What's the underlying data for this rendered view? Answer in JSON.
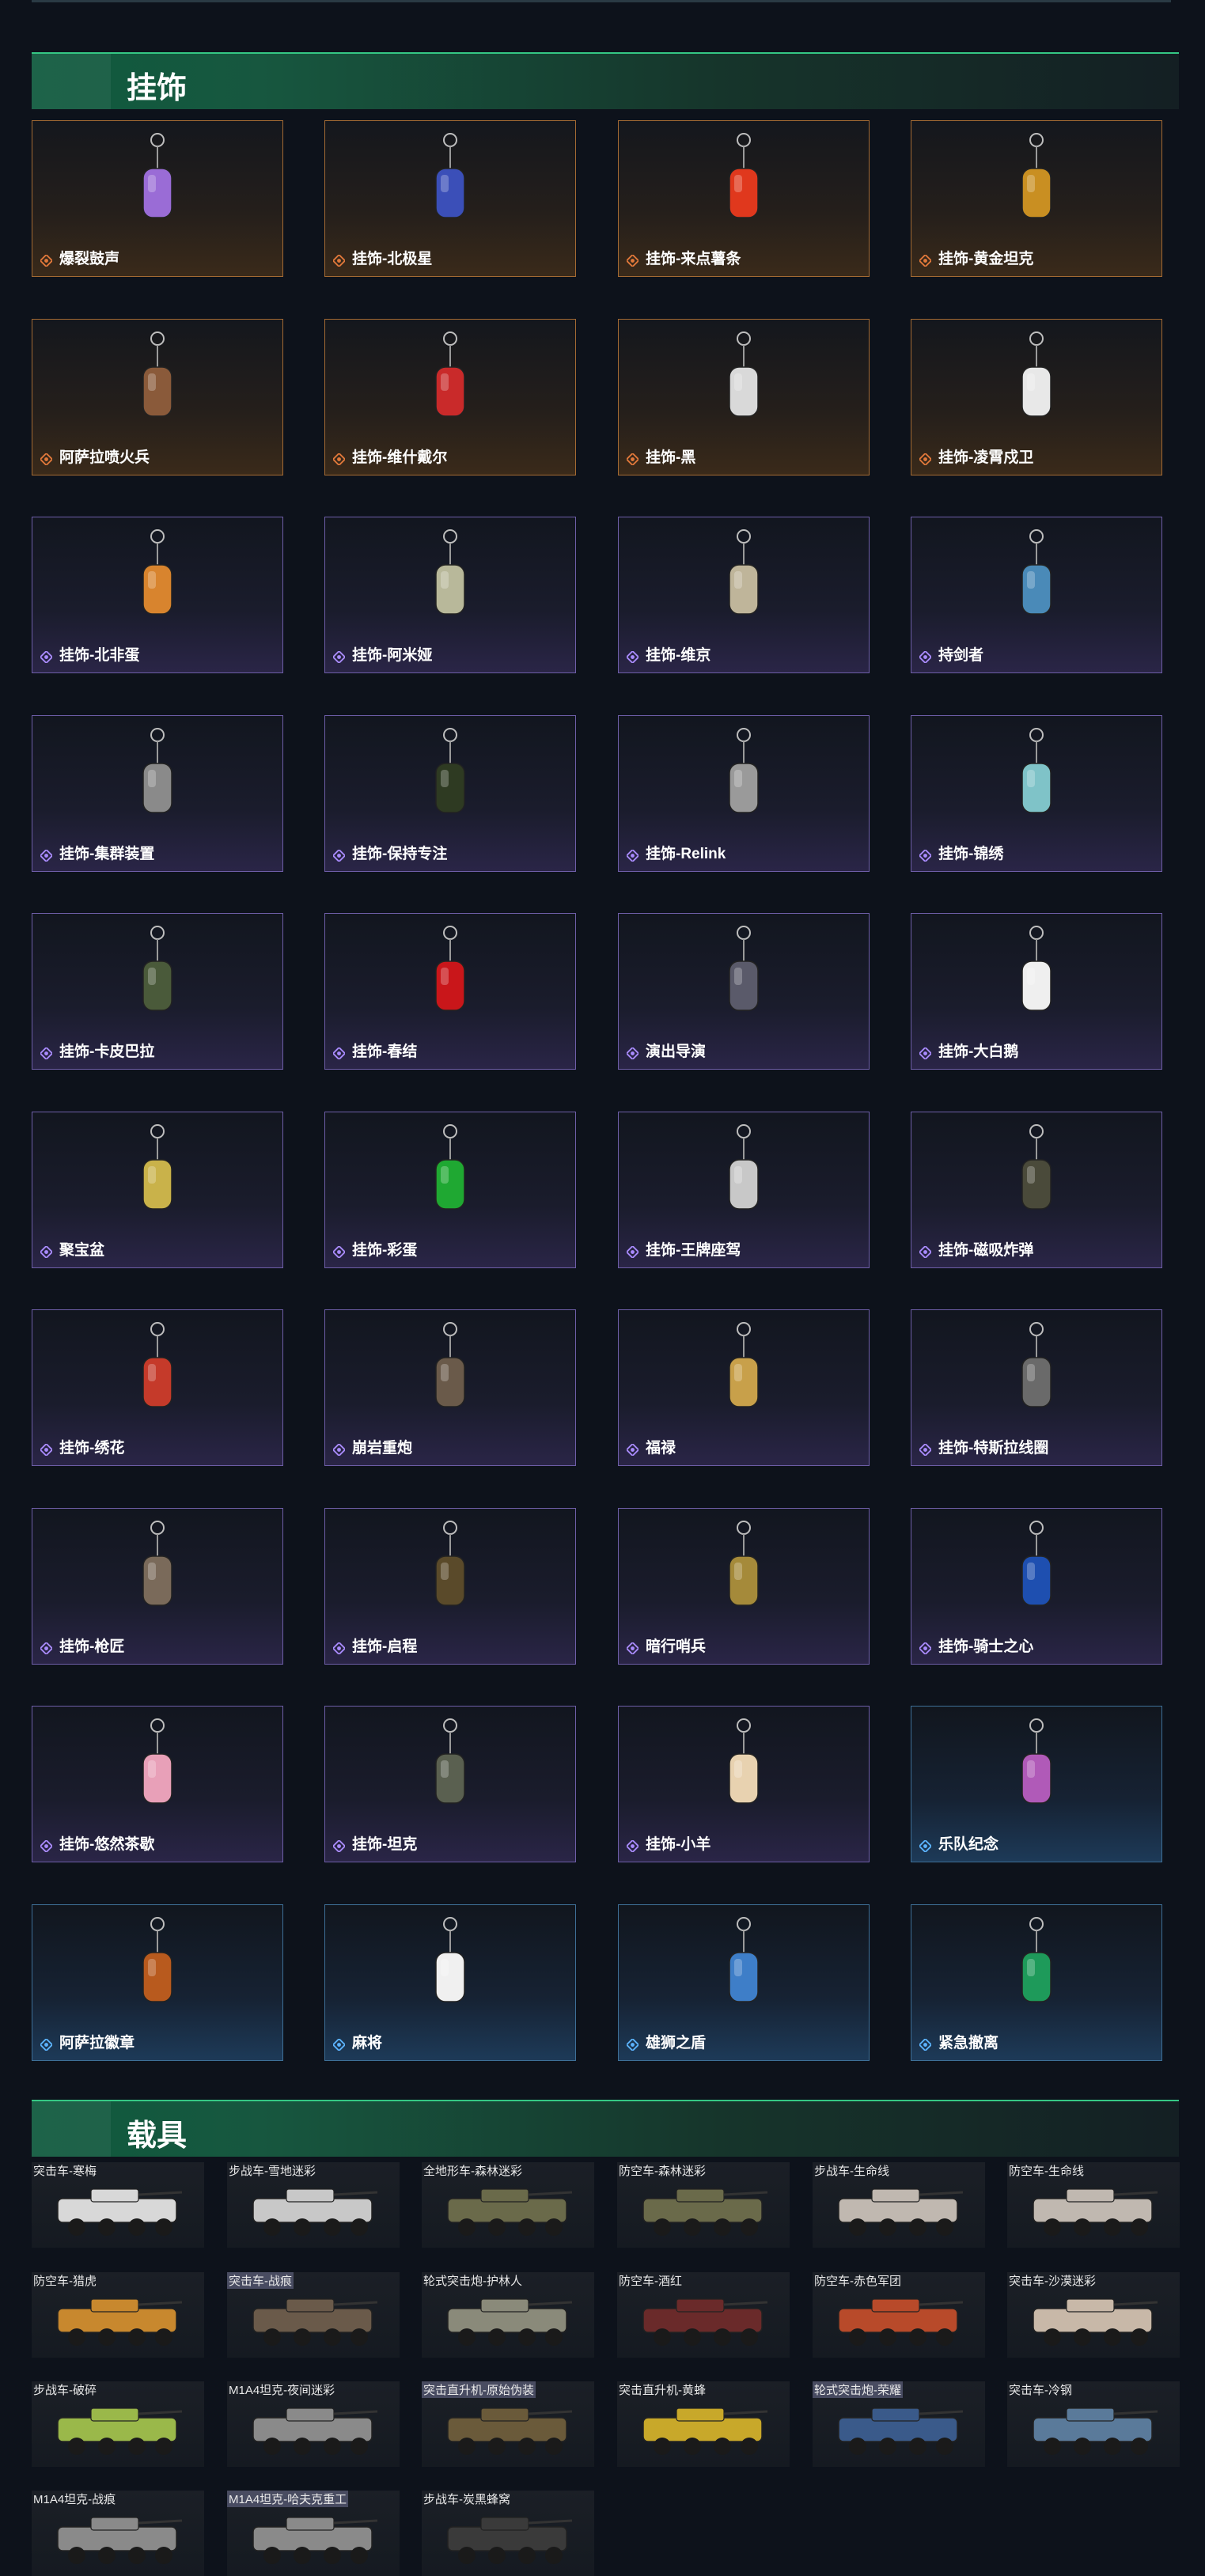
{
  "sections": {
    "charms_title": "挂饰",
    "vehicles_title": "载具"
  },
  "rarity_colors": {
    "orange": "#e0783a",
    "purple": "#a98bff",
    "blue": "#5cb3ff"
  },
  "charms": [
    {
      "name": "爆裂鼓声",
      "rarity": "orange",
      "icon": "figure-charm-icon",
      "color": "#9a6cd6"
    },
    {
      "name": "挂饰-北极星",
      "rarity": "orange",
      "icon": "star-charm-icon",
      "color": "#3b4fb8"
    },
    {
      "name": "挂饰-来点薯条",
      "rarity": "orange",
      "icon": "fries-charm-icon",
      "color": "#e0381d"
    },
    {
      "name": "挂饰-黄金坦克",
      "rarity": "orange",
      "icon": "gold-tank-charm-icon",
      "color": "#c98f22"
    },
    {
      "name": "阿萨拉喷火兵",
      "rarity": "orange",
      "icon": "soldier-charm-icon",
      "color": "#8a5a3a"
    },
    {
      "name": "挂饰-维什戴尔",
      "rarity": "orange",
      "icon": "blade-charm-icon",
      "color": "#c92a2a"
    },
    {
      "name": "挂饰-黑",
      "rarity": "orange",
      "icon": "blade-charm-icon",
      "color": "#d9d9d9"
    },
    {
      "name": "挂饰-凌霄戍卫",
      "rarity": "orange",
      "icon": "guard-charm-icon",
      "color": "#e8e8e8"
    },
    {
      "name": "挂饰-北非蛋",
      "rarity": "purple",
      "icon": "egg-charm-icon",
      "color": "#d8842e"
    },
    {
      "name": "挂饰-阿米娅",
      "rarity": "purple",
      "icon": "bunny-charm-icon",
      "color": "#b8b89a"
    },
    {
      "name": "挂饰-维京",
      "rarity": "purple",
      "icon": "hammer-charm-icon",
      "color": "#bfb59a"
    },
    {
      "name": "持剑者",
      "rarity": "purple",
      "icon": "knight-charm-icon",
      "color": "#4a8ab8"
    },
    {
      "name": "挂饰-集群装置",
      "rarity": "purple",
      "icon": "diamond-charm-icon",
      "color": "#8a8a8a"
    },
    {
      "name": "挂饰-保持专注",
      "rarity": "purple",
      "icon": "sign-charm-icon",
      "color": "#2e3a22"
    },
    {
      "name": "挂饰-Relink",
      "rarity": "purple",
      "icon": "ring-charm-icon",
      "color": "#9a9a9a"
    },
    {
      "name": "挂饰-锦绣",
      "rarity": "purple",
      "icon": "butterfly-charm-icon",
      "color": "#7fc3c8"
    },
    {
      "name": "挂饰-卡皮巴拉",
      "rarity": "purple",
      "icon": "capybara-charm-icon",
      "color": "#4a5a3a"
    },
    {
      "name": "挂饰-春结",
      "rarity": "purple",
      "icon": "knot-charm-icon",
      "color": "#c9161a"
    },
    {
      "name": "演出导演",
      "rarity": "purple",
      "icon": "figure-charm-icon",
      "color": "#5a5a6a"
    },
    {
      "name": "挂饰-大白鹅",
      "rarity": "purple",
      "icon": "goose-charm-icon",
      "color": "#efefef"
    },
    {
      "name": "聚宝盆",
      "rarity": "purple",
      "icon": "bowl-charm-icon",
      "color": "#c9b24a"
    },
    {
      "name": "挂饰-彩蛋",
      "rarity": "purple",
      "icon": "egg-charm-icon",
      "color": "#1fa832"
    },
    {
      "name": "挂饰-王牌座驾",
      "rarity": "purple",
      "icon": "plane-charm-icon",
      "color": "#c8c8c8"
    },
    {
      "name": "挂饰-磁吸炸弹",
      "rarity": "purple",
      "icon": "bomb-charm-icon",
      "color": "#4a4a3a"
    },
    {
      "name": "挂饰-绣花",
      "rarity": "purple",
      "icon": "flower-charm-icon",
      "color": "#c53a2a"
    },
    {
      "name": "崩岩重炮",
      "rarity": "purple",
      "icon": "figure-charm-icon",
      "color": "#6a5a4a"
    },
    {
      "name": "福禄",
      "rarity": "purple",
      "icon": "gourd-charm-icon",
      "color": "#c8a04a"
    },
    {
      "name": "挂饰-特斯拉线圈",
      "rarity": "purple",
      "icon": "coil-charm-icon",
      "color": "#6a6a6a"
    },
    {
      "name": "挂饰-枪匠",
      "rarity": "purple",
      "icon": "vest-charm-icon",
      "color": "#7a6a5a"
    },
    {
      "name": "挂饰-启程",
      "rarity": "purple",
      "icon": "medal-charm-icon",
      "color": "#5a4a2a"
    },
    {
      "name": "暗行哨兵",
      "rarity": "purple",
      "icon": "figure-charm-icon",
      "color": "#a58a3a"
    },
    {
      "name": "挂饰-骑士之心",
      "rarity": "purple",
      "icon": "armor-charm-icon",
      "color": "#1e4fb0"
    },
    {
      "name": "挂饰-悠然茶歇",
      "rarity": "purple",
      "icon": "cake-charm-icon",
      "color": "#e8a0b8"
    },
    {
      "name": "挂饰-坦克",
      "rarity": "purple",
      "icon": "tank-charm-icon",
      "color": "#5a6050"
    },
    {
      "name": "挂饰-小羊",
      "rarity": "purple",
      "icon": "lamb-charm-icon",
      "color": "#e8d2b0"
    },
    {
      "name": "乐队纪念",
      "rarity": "blue",
      "icon": "badge-charm-icon",
      "color": "#b05ab8"
    },
    {
      "name": "阿萨拉徽章",
      "rarity": "blue",
      "icon": "emblem-charm-icon",
      "color": "#b85a1e"
    },
    {
      "name": "麻将",
      "rarity": "blue",
      "icon": "tile-charm-icon",
      "color": "#f0f0f0"
    },
    {
      "name": "雄狮之盾",
      "rarity": "blue",
      "icon": "shield-charm-icon",
      "color": "#3e7ec8"
    },
    {
      "name": "紧急撤离",
      "rarity": "blue",
      "icon": "tag-charm-icon",
      "color": "#1e9a5a"
    }
  ],
  "vehicles": [
    {
      "label": "突击车-寒梅",
      "highlight": false,
      "color": "#d8d8d8"
    },
    {
      "label": "步战车-雪地迷彩",
      "highlight": false,
      "color": "#c8c8c8"
    },
    {
      "label": "全地形车-森林迷彩",
      "highlight": false,
      "color": "#6a6a4a"
    },
    {
      "label": "防空车-森林迷彩",
      "highlight": false,
      "color": "#6a6a4a"
    },
    {
      "label": "步战车-生命线",
      "highlight": false,
      "color": "#c0b8b0"
    },
    {
      "label": "防空车-生命线",
      "highlight": false,
      "color": "#c0b8b0"
    },
    {
      "label": "防空车-猎虎",
      "highlight": false,
      "color": "#c8882e"
    },
    {
      "label": "突击车-战痕",
      "highlight": true,
      "color": "#6a5a4a"
    },
    {
      "label": "轮式突击炮-护林人",
      "highlight": false,
      "color": "#8a8a7a"
    },
    {
      "label": "防空车-酒红",
      "highlight": false,
      "color": "#6a2a2a"
    },
    {
      "label": "防空车-赤色军团",
      "highlight": false,
      "color": "#b84a2a"
    },
    {
      "label": "突击车-沙漠迷彩",
      "highlight": false,
      "color": "#c8b8a8"
    },
    {
      "label": "步战车-破碎",
      "highlight": false,
      "color": "#9ab84a"
    },
    {
      "label": "M1A4坦克-夜间迷彩",
      "highlight": false,
      "color": "#8a8a8a"
    },
    {
      "label": "突击直升机-原始伪装",
      "highlight": true,
      "color": "#6a5a3a"
    },
    {
      "label": "突击直升机-黄蜂",
      "highlight": false,
      "color": "#c8a82a"
    },
    {
      "label": "轮式突击炮-荣耀",
      "highlight": true,
      "color": "#3a5a8a"
    },
    {
      "label": "突击车-冷钢",
      "highlight": false,
      "color": "#5a7a9a"
    },
    {
      "label": "M1A4坦克-战痕",
      "highlight": false,
      "color": "#8a8a8a"
    },
    {
      "label": "M1A4坦克-哈夫克重工",
      "highlight": true,
      "color": "#8a8a8a"
    },
    {
      "label": "步战车-炭黑蜂窝",
      "highlight": false,
      "color": "#3a3a3a"
    }
  ]
}
